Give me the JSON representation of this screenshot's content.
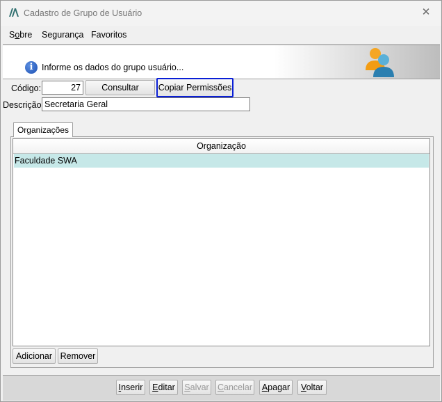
{
  "window": {
    "title": "Cadastro de Grupo de Usuário"
  },
  "menu": [
    {
      "label": "Sobre",
      "mnemonic": "o"
    },
    {
      "label": "Segurança"
    },
    {
      "label": "Favoritos"
    }
  ],
  "banner": {
    "info_text": "Informe os dados do grupo usuário..."
  },
  "form": {
    "codigo_label": "Código:",
    "codigo_value": "27",
    "consultar_label": "Consultar",
    "copiar_label": "Copiar Permissões",
    "descricao_label": "Descrição:",
    "descricao_value": "Secretaria Geral"
  },
  "tabs": [
    {
      "label": "Organizações",
      "active": true
    }
  ],
  "grid": {
    "columns": [
      "Organização"
    ],
    "rows": [
      [
        "Faculdade SWA"
      ]
    ]
  },
  "panel_buttons": {
    "adicionar": "Adicionar",
    "remover": "Remover"
  },
  "footer_buttons": {
    "inserir": {
      "pre": "",
      "key": "I",
      "post": "nserir"
    },
    "editar": {
      "pre": "",
      "key": "E",
      "post": "ditar"
    },
    "salvar": {
      "pre": "",
      "key": "S",
      "post": "alvar"
    },
    "cancelar": {
      "pre": "",
      "key": "C",
      "post": "ancelar"
    },
    "apagar": {
      "pre": "",
      "key": "A",
      "post": "pagar"
    },
    "voltar": {
      "pre": "",
      "key": "V",
      "post": "oltar"
    }
  },
  "colors": {
    "focus_border": "#0a1fd6",
    "selected_row": "#c6e8e8"
  }
}
